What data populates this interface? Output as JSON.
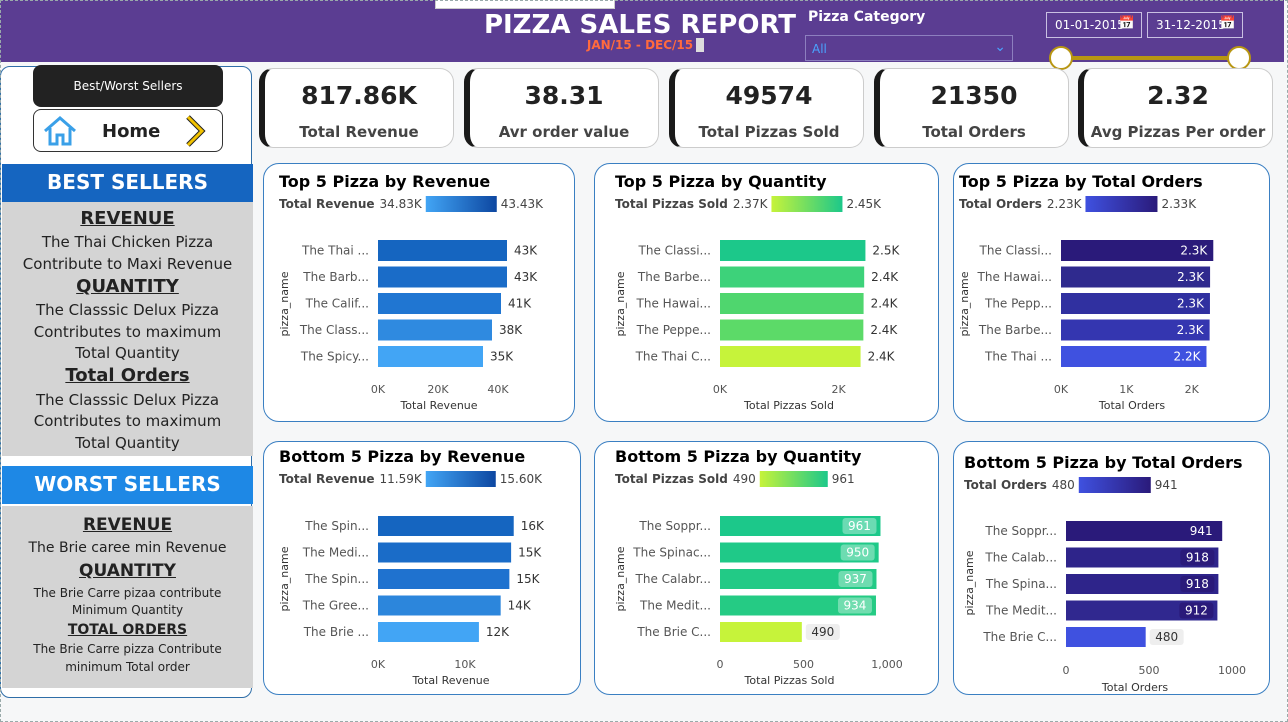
{
  "header": {
    "title": "PIZZA SALES REPORT",
    "subtitle": "JAN/15 - DEC/15",
    "category_label": "Pizza Category",
    "category_value": "All",
    "date_from": "01-01-2015",
    "date_to": "31-12-2015",
    "colors": {
      "background": "#5b3d92",
      "subtitle": "#ff6a3d"
    }
  },
  "nav": {
    "best_worst_label": "Best/Worst Sellers",
    "home_label": "Home"
  },
  "best": {
    "title": "BEST SELLERS",
    "revenue_h": "REVENUE",
    "revenue_l1": "The Thai Chicken Pizza",
    "revenue_l2": "Contribute to Maxi Revenue",
    "quantity_h": "QUANTITY",
    "quantity_l1": "The Classsic Delux Pizza",
    "quantity_l2": "Contributes to maximum",
    "quantity_l3": "Total Quantity",
    "orders_h": "Total Orders",
    "orders_l1": "The Classsic Delux Pizza",
    "orders_l2": "Contributes to maximum",
    "orders_l3": "Total  Quantity"
  },
  "worst": {
    "title": "WORST SELLERS",
    "revenue_h": "REVENUE",
    "revenue_l1": "The Brie caree min Revenue",
    "quantity_h": "QUANTITY",
    "quantity_l1": "The Brie Carre pizaa contribute",
    "quantity_l2": "Minimum Quantity",
    "orders_h": "TOTAL ORDERS",
    "orders_l1": "The Brie Carre pizza Contribute",
    "orders_l2": "minimum Total order"
  },
  "kpis": [
    {
      "value": "817.86K",
      "label": "Total Revenue"
    },
    {
      "value": "38.31",
      "label": "Avr order value"
    },
    {
      "value": "49574",
      "label": "Total Pizzas Sold"
    },
    {
      "value": "21350",
      "label": "Total Orders"
    },
    {
      "value": "2.32",
      "label": "Avg Pizzas Per order"
    }
  ],
  "chart_data": [
    {
      "type": "bar",
      "title": "Top 5 Pizza by Revenue",
      "legend_label": "Total Revenue",
      "legend_min": "34.83K",
      "legend_max": "43.43K",
      "categories": [
        "The Thai ...",
        "The Barb...",
        "The Calif...",
        "The Class...",
        "The Spicy..."
      ],
      "values": [
        43000,
        43000,
        41000,
        38000,
        35000
      ],
      "labels": [
        "43K",
        "43K",
        "41K",
        "38K",
        "35K"
      ],
      "ylabel": "pizza_name",
      "xlabel": "Total Revenue",
      "xlim": [
        0,
        50000
      ],
      "xticks": [
        0,
        20000,
        40000
      ],
      "xtick_labels": [
        "0K",
        "20K",
        "40K"
      ],
      "colors": [
        "#1565c0",
        "#1a6cc8",
        "#2076d2",
        "#2f8ae0",
        "#42a5f5"
      ],
      "label_inside": false,
      "legend_grad": [
        "#42a5f5",
        "#0d47a1"
      ]
    },
    {
      "type": "bar",
      "title": "Top 5 Pizza by Quantity",
      "legend_label": "Total Pizzas Sold",
      "legend_min": "2.37K",
      "legend_max": "2.45K",
      "categories": [
        "The Classi...",
        "The Barbe...",
        "The Hawai...",
        "The Peppe...",
        "The Thai C..."
      ],
      "values": [
        2453,
        2432,
        2422,
        2418,
        2371
      ],
      "labels": [
        "2.5K",
        "2.4K",
        "2.4K",
        "2.4K",
        "2.4K"
      ],
      "ylabel": "pizza_name",
      "xlabel": "Total Pizzas Sold",
      "xlim": [
        0,
        2800
      ],
      "xticks": [
        0,
        2000
      ],
      "xtick_labels": [
        "0K",
        "2K"
      ],
      "colors": [
        "#1cc88a",
        "#3dd27a",
        "#4fd66e",
        "#5cda68",
        "#c6f33a"
      ],
      "label_inside": false,
      "legend_grad": [
        "#c6f33a",
        "#1cc88a"
      ]
    },
    {
      "type": "bar",
      "title": "Top 5 Pizza by Total Orders",
      "legend_label": "Total Orders",
      "legend_min": "2.23K",
      "legend_max": "2.33K",
      "categories": [
        "The Classi...",
        "The Hawai...",
        "The Pepp...",
        "The Barbe...",
        "The Thai ..."
      ],
      "values": [
        2329,
        2280,
        2278,
        2273,
        2225
      ],
      "labels": [
        "2.3K",
        "2.3K",
        "2.3K",
        "2.3K",
        "2.2K"
      ],
      "ylabel": "pizza_name",
      "xlabel": "Total Orders",
      "xlim": [
        0,
        2600
      ],
      "xticks": [
        0,
        1000,
        2000
      ],
      "xtick_labels": [
        "0K",
        "1K",
        "2K"
      ],
      "colors": [
        "#2a1a7a",
        "#2f2a8e",
        "#3030a0",
        "#3436b0",
        "#3f51e0"
      ],
      "label_inside": true,
      "legend_grad": [
        "#3f51e0",
        "#2a1a7a"
      ]
    },
    {
      "type": "bar",
      "title": "Bottom 5 Pizza by Revenue",
      "legend_label": "Total Revenue",
      "legend_min": "11.59K",
      "legend_max": "15.60K",
      "categories": [
        "The Spin...",
        "The Medi...",
        "The Spin...",
        "The Gree...",
        "The Brie ..."
      ],
      "values": [
        15600,
        15300,
        15100,
        14100,
        11600
      ],
      "labels": [
        "16K",
        "15K",
        "15K",
        "14K",
        "12K"
      ],
      "ylabel": "pizza_name",
      "xlabel": "Total Revenue",
      "xlim": [
        0,
        20000
      ],
      "xticks": [
        0,
        10000
      ],
      "xtick_labels": [
        "0K",
        "10K"
      ],
      "colors": [
        "#1565c0",
        "#1a6cc8",
        "#1f72cf",
        "#2c86dc",
        "#42a5f5"
      ],
      "label_inside": false,
      "legend_grad": [
        "#42a5f5",
        "#0d47a1"
      ]
    },
    {
      "type": "bar",
      "title": "Bottom 5 Pizza by Quantity",
      "legend_label": "Total Pizzas Sold",
      "legend_min": "490",
      "legend_max": "961",
      "categories": [
        "The Soppr...",
        "The Spinac...",
        "The Calabr...",
        "The Medit...",
        "The Brie C..."
      ],
      "values": [
        961,
        950,
        937,
        934,
        490
      ],
      "labels": [
        "961",
        "950",
        "937",
        "934",
        "490"
      ],
      "ylabel": "pizza_name",
      "xlabel": "Total Pizzas Sold",
      "xlim": [
        0,
        1000
      ],
      "xticks": [
        0,
        500,
        1000
      ],
      "xtick_labels": [
        "0",
        "500",
        "1,000"
      ],
      "colors": [
        "#1cc88a",
        "#1fc988",
        "#22ca86",
        "#25cb84",
        "#c6f33a"
      ],
      "label_inside": "pill",
      "legend_grad": [
        "#c6f33a",
        "#1cc88a"
      ]
    },
    {
      "type": "bar",
      "title": "Bottom 5 Pizza by Total Orders",
      "legend_label": "Total Orders",
      "legend_min": "480",
      "legend_max": "941",
      "categories": [
        "The Soppr...",
        "The Calab...",
        "The Spina...",
        "The Medit...",
        "The Brie C..."
      ],
      "values": [
        941,
        918,
        918,
        912,
        480
      ],
      "labels": [
        "941",
        "918",
        "918",
        "912",
        "480"
      ],
      "ylabel": "pizza_name",
      "xlabel": "Total Orders",
      "xlim": [
        0,
        1000
      ],
      "xticks": [
        0,
        500,
        1000
      ],
      "xtick_labels": [
        "0",
        "500",
        "1000"
      ],
      "colors": [
        "#2a1a7a",
        "#2e248a",
        "#2e248a",
        "#30288f",
        "#3f51e0"
      ],
      "label_inside": "dark",
      "legend_grad": [
        "#3f51e0",
        "#2a1a7a"
      ]
    }
  ]
}
